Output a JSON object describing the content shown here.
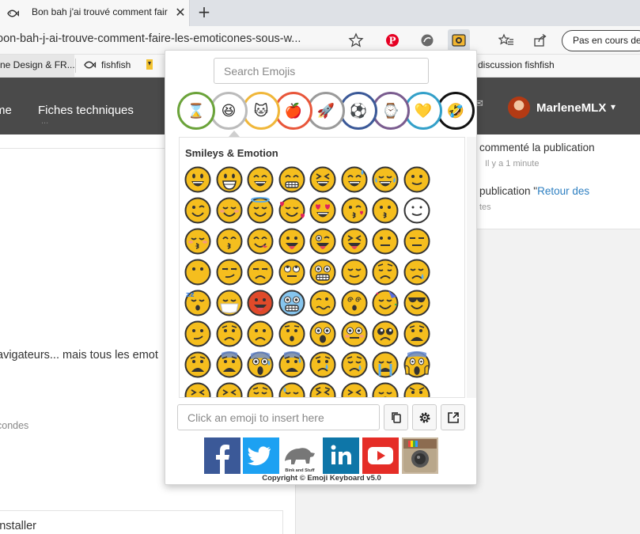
{
  "browser": {
    "tab_title": "Bon bah j'ai trouvé comment faire les émoticônes sous w",
    "tab_close": "✕",
    "new_tab": "+",
    "url": "oon-bah-j-ai-trouve-comment-faire-les-emoticones-sous-w...",
    "sync_label": "Pas en cours de s",
    "bookmarks": [
      "ne Design & FR...",
      "fishfish",
      "discussion fishfish"
    ]
  },
  "site": {
    "nav_items": [
      "me",
      "Fiches techniques"
    ],
    "nav_faded": "...",
    "user_name": "MarleneMLX",
    "user_caret": "▾",
    "left_texts": [
      "avigateurs... mais tous les emot",
      "condes",
      "installer"
    ],
    "right_texts": [
      "commenté la publication",
      "Il y a 1 minute",
      "publication \"",
      "Retour des",
      "tes"
    ]
  },
  "popup": {
    "search_placeholder": "Search Emojis",
    "section_title": "Smileys & Emotion",
    "insert_placeholder": "Click an emoji to insert here",
    "copyright": "Copyright © Emoji Keyboard v5.0",
    "categories": [
      {
        "name": "recent",
        "icon": "⌛",
        "color": "#6ba33a"
      },
      {
        "name": "smileys",
        "icon": "😆",
        "color": "#bbbbbb"
      },
      {
        "name": "animals",
        "icon": "🐱",
        "color": "#f0b73a"
      },
      {
        "name": "food",
        "icon": "🍎",
        "color": "#e8563a"
      },
      {
        "name": "travel",
        "icon": "🚀",
        "color": "#9a9a9a"
      },
      {
        "name": "activity",
        "icon": "⚽",
        "color": "#3b5998"
      },
      {
        "name": "objects",
        "icon": "⌚",
        "color": "#7a5c8f"
      },
      {
        "name": "symbols",
        "icon": "💛",
        "color": "#33a0c9"
      },
      {
        "name": "flags",
        "icon": "🤣",
        "color": "#111111"
      }
    ],
    "social": [
      "facebook",
      "twitter",
      "bink-and-stuff",
      "linkedin",
      "youtube",
      "instagram"
    ],
    "social_colors": {
      "facebook": "#3b5998",
      "twitter": "#1da1f2",
      "linkedin": "#0e76a8",
      "youtube": "#e52d27",
      "instagram": "#c9b8a0"
    },
    "bink_label": "Bink and Stuff",
    "emojis": [
      [
        "grinning",
        "grinning-big",
        "smile",
        "grin",
        "laughing",
        "sweat-smile",
        "joy",
        "slight-smile"
      ],
      [
        "wink",
        "blush",
        "innocent",
        "hearts",
        "heart-eyes",
        "kiss-heart",
        "kissing",
        "white-smile"
      ],
      [
        "kiss-blush",
        "kiss-smile",
        "yum",
        "tongue",
        "tongue-wink",
        "tongue-squint",
        "neutral",
        "expressionless"
      ],
      [
        "no-mouth",
        "smirk",
        "unamused",
        "rolling-eyes",
        "grimace",
        "relieved",
        "pensive",
        "sleepy"
      ],
      [
        "sleeping",
        "masked",
        "hot",
        "cold",
        "woozy",
        "dizzy",
        "party",
        "cool"
      ],
      [
        "confused",
        "worried",
        "slight-frown",
        "hushed",
        "astonished",
        "flushed",
        "pleading",
        "frown-open"
      ],
      [
        "anguished",
        "fearful",
        "scream-sweat",
        "cold-sweat",
        "cry",
        "sad",
        "sob",
        "scream"
      ],
      [
        "confounded",
        "persevere",
        "disappointed",
        "sweat",
        "weary",
        "tired",
        "yawn",
        "angry"
      ]
    ]
  }
}
